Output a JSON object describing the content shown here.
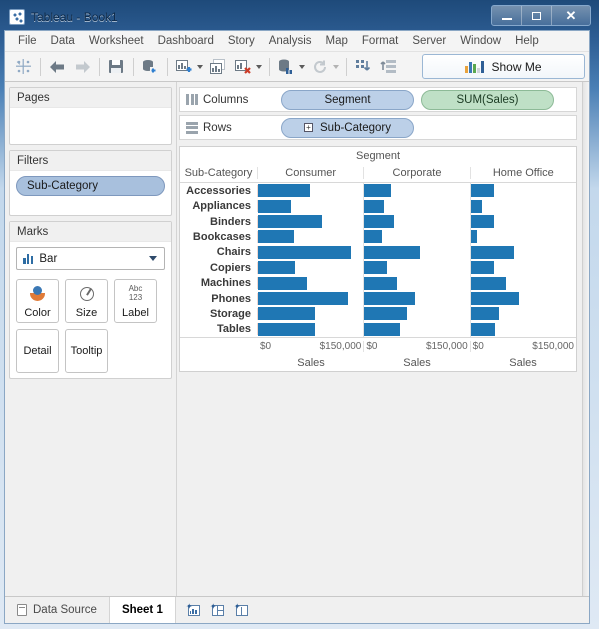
{
  "window": {
    "title": "Tableau - Book1",
    "app_icon": "tableau-logo-icon",
    "minimize_label": "–",
    "maximize_label": "□",
    "close_label": "✕"
  },
  "menubar": {
    "items": [
      {
        "label": "File"
      },
      {
        "label": "Data"
      },
      {
        "label": "Worksheet"
      },
      {
        "label": "Dashboard"
      },
      {
        "label": "Story"
      },
      {
        "label": "Analysis"
      },
      {
        "label": "Map"
      },
      {
        "label": "Format"
      },
      {
        "label": "Server"
      },
      {
        "label": "Window"
      },
      {
        "label": "Help"
      }
    ]
  },
  "toolbar": {
    "buttons": [
      {
        "name": "tableau-home-icon"
      },
      {
        "name": "back-arrow-icon"
      },
      {
        "name": "forward-arrow-icon"
      },
      {
        "name": "save-icon"
      },
      {
        "name": "connect-data-icon"
      },
      {
        "name": "new-worksheet-icon"
      },
      {
        "name": "duplicate-sheet-icon"
      },
      {
        "name": "clear-sheet-icon"
      },
      {
        "name": "swap-rows-columns-icon"
      },
      {
        "name": "refresh-icon"
      },
      {
        "name": "sort-ascending-icon"
      },
      {
        "name": "sort-descending-icon"
      },
      {
        "name": "totals-icon"
      }
    ],
    "show_me": {
      "label": "Show Me",
      "icon": "show-me-bars-icon",
      "bar_colors": [
        "#e8a33d",
        "#3b78b5",
        "#5aa84f",
        "#e0e0e0",
        "#2f5f96"
      ]
    }
  },
  "sidebar": {
    "pages": {
      "title": "Pages",
      "content": ""
    },
    "filters": {
      "title": "Filters",
      "pills": [
        {
          "label": "Sub-Category"
        }
      ]
    },
    "marks": {
      "title": "Marks",
      "mark_type": "Bar",
      "mark_type_icon": "bar-mark-icon",
      "buttons": [
        {
          "label": "Color",
          "icon": "color-palette-icon"
        },
        {
          "label": "Size",
          "icon": "size-circle-icon"
        },
        {
          "label": "Label",
          "icon": "abc-123-icon",
          "icon_text_top": "Abc",
          "icon_text_bottom": "123"
        },
        {
          "label": "Detail",
          "icon": "detail-icon"
        },
        {
          "label": "Tooltip",
          "icon": "tooltip-icon"
        }
      ]
    }
  },
  "shelves": {
    "columns": {
      "label": "Columns",
      "icon": "columns-icon",
      "pills": [
        {
          "label": "Segment",
          "type": "dimension"
        },
        {
          "label": "SUM(Sales)",
          "type": "measure"
        }
      ]
    },
    "rows": {
      "label": "Rows",
      "icon": "rows-icon",
      "pills": [
        {
          "label": "Sub-Category",
          "type": "dimension",
          "expand_glyph": "+"
        }
      ]
    }
  },
  "chart_data": {
    "type": "bar",
    "title": "Segment",
    "row_field_label": "Sub-Category",
    "xlabel": "Sales",
    "ylabel": "Sub-Category",
    "xlim": [
      0,
      190000
    ],
    "axis_ticks": [
      "$0",
      "$150,000"
    ],
    "grid": false,
    "legend": "none",
    "bar_color": "#1f77b4",
    "categories": [
      "Accessories",
      "Appliances",
      "Binders",
      "Bookcases",
      "Chairs",
      "Copiers",
      "Machines",
      "Phones",
      "Storage",
      "Tables"
    ],
    "series": [
      {
        "name": "Consumer",
        "values": [
          94000,
          59000,
          115000,
          65000,
          168000,
          66000,
          88000,
          162000,
          102000,
          103000
        ]
      },
      {
        "name": "Corporate",
        "values": [
          48000,
          35000,
          54000,
          31000,
          100000,
          41000,
          59000,
          92000,
          77000,
          65000
        ]
      },
      {
        "name": "Home Office",
        "values": [
          43000,
          20000,
          42000,
          11000,
          78000,
          43000,
          64000,
          88000,
          51000,
          44000
        ]
      }
    ]
  },
  "tabbar": {
    "data_source": {
      "label": "Data Source",
      "icon": "data-source-icon"
    },
    "sheets": [
      {
        "label": "Sheet 1",
        "active": true
      }
    ],
    "actions": [
      {
        "name": "new-worksheet-icon"
      },
      {
        "name": "new-dashboard-icon"
      },
      {
        "name": "new-story-icon"
      }
    ]
  }
}
